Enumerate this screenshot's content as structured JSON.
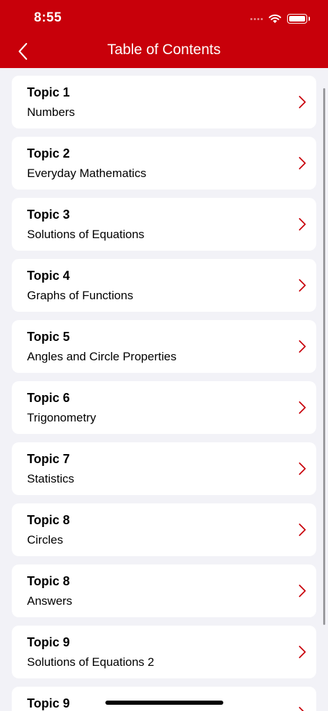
{
  "status_bar": {
    "time": "8:55"
  },
  "nav": {
    "title": "Table of Contents",
    "back_icon": "chevron-left-icon"
  },
  "colors": {
    "brand": "#c8000a",
    "background": "#f2f2f7",
    "chevron": "#c8000a"
  },
  "topics": [
    {
      "title": "Topic 1",
      "subtitle": "Numbers"
    },
    {
      "title": "Topic 2",
      "subtitle": "Everyday Mathematics"
    },
    {
      "title": "Topic 3",
      "subtitle": "Solutions of Equations"
    },
    {
      "title": "Topic 4",
      "subtitle": "Graphs of Functions"
    },
    {
      "title": "Topic 5",
      "subtitle": "Angles and Circle Properties"
    },
    {
      "title": "Topic 6",
      "subtitle": "Trigonometry"
    },
    {
      "title": "Topic 7",
      "subtitle": "Statistics"
    },
    {
      "title": "Topic 8",
      "subtitle": "Circles"
    },
    {
      "title": "Topic 8",
      "subtitle": "Answers"
    },
    {
      "title": "Topic 9",
      "subtitle": "Solutions of Equations 2"
    },
    {
      "title": "Topic 9",
      "subtitle": ""
    }
  ]
}
